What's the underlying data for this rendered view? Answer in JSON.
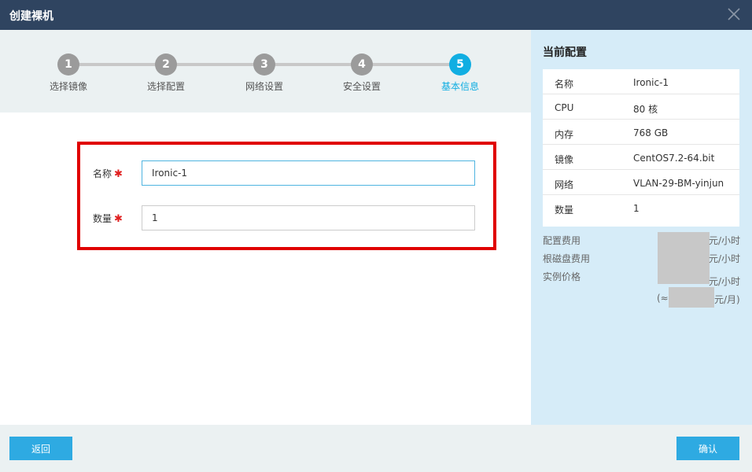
{
  "window": {
    "title": "创建裸机"
  },
  "steps": [
    {
      "num": "1",
      "label": "选择镜像"
    },
    {
      "num": "2",
      "label": "选择配置"
    },
    {
      "num": "3",
      "label": "网络设置"
    },
    {
      "num": "4",
      "label": "安全设置"
    },
    {
      "num": "5",
      "label": "基本信息"
    }
  ],
  "active_step": 5,
  "form": {
    "name": {
      "label": "名称",
      "required_mark": "✱",
      "value": "Ironic-1"
    },
    "quantity": {
      "label": "数量",
      "required_mark": "✱",
      "value": "1"
    }
  },
  "summary": {
    "title": "当前配置",
    "rows": [
      {
        "key": "名称",
        "value": "Ironic-1"
      },
      {
        "key": "CPU",
        "value": "80 核"
      },
      {
        "key": "内存",
        "value": "768 GB"
      },
      {
        "key": "镜像",
        "value": "CentOS7.2-64.bit"
      },
      {
        "key": "网络",
        "value": "VLAN-29-BM-yinjun"
      },
      {
        "key": "数量",
        "value": "1"
      }
    ],
    "costs": {
      "config_fee_label": "配置费用",
      "disk_fee_label": "根磁盘费用",
      "instance_price_label": "实例价格",
      "per_hour_1": "元/小时",
      "per_hour_2": "元/小时",
      "per_hour_3": "元/小时",
      "approx_prefix": "(≈",
      "per_month": "元/月)"
    }
  },
  "footer": {
    "back_label": "返回",
    "confirm_label": "确认"
  },
  "colors": {
    "titlebar": "#2f4460",
    "accent": "#11aee2",
    "button": "#2eaae2",
    "required": "#e02020",
    "highlight_border": "#e00000"
  }
}
